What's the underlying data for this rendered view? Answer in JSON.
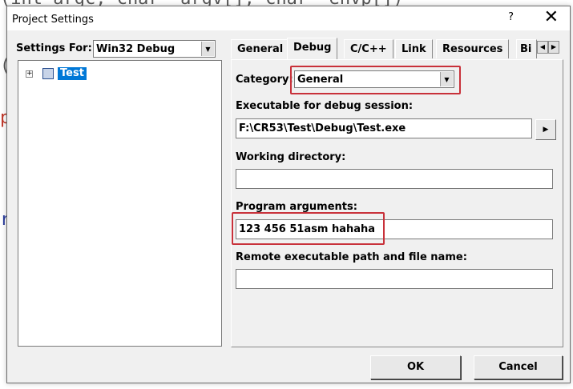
{
  "window": {
    "title": "Project Settings",
    "help_label": "?",
    "close_label": "✕"
  },
  "settings_for": {
    "label": "Settings For:",
    "value": "Win32 Debug"
  },
  "tree": {
    "expander": "+",
    "item_label": "Test"
  },
  "tabs": [
    "General",
    "Debug",
    "C/C++",
    "Link",
    "Resources",
    "Bi"
  ],
  "debug": {
    "category_label": "Category:",
    "category_value": "General",
    "exe_label": "Executable for debug session:",
    "exe_value": "F:\\CR53\\Test\\Debug\\Test.exe",
    "workdir_label": "Working directory:",
    "workdir_value": "",
    "args_label": "Program arguments:",
    "args_value": "123 456 51asm hahaha",
    "remote_label": "Remote executable path and file name:",
    "remote_value": ""
  },
  "buttons": {
    "ok": "OK",
    "cancel": "Cancel"
  },
  "icons": {
    "dropdown": "chevron-down-icon",
    "browse": "chevron-right-icon",
    "tab_left": "chevron-left-icon",
    "tab_right": "chevron-right-icon",
    "project": "project-icon"
  },
  "colors": {
    "selection": "#0078d7",
    "highlight_box": "#c8313a",
    "dialog_bg": "#f0f0f0"
  }
}
